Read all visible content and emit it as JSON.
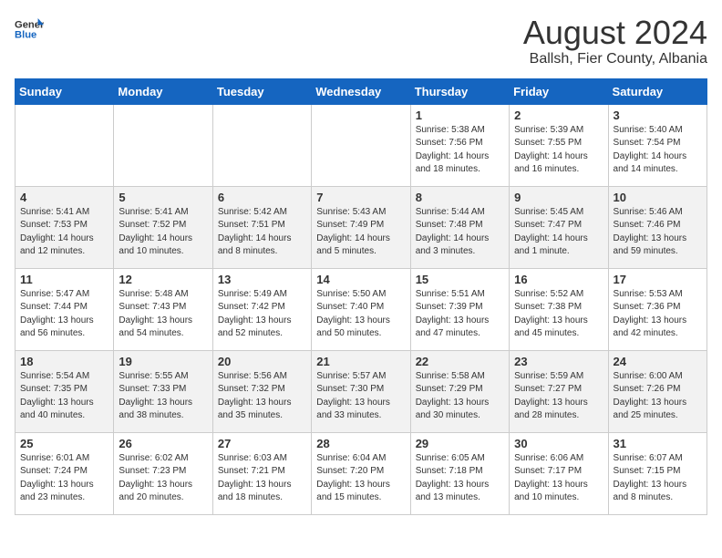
{
  "header": {
    "logo_general": "General",
    "logo_blue": "Blue",
    "month_year": "August 2024",
    "location": "Ballsh, Fier County, Albania"
  },
  "days_of_week": [
    "Sunday",
    "Monday",
    "Tuesday",
    "Wednesday",
    "Thursday",
    "Friday",
    "Saturday"
  ],
  "weeks": [
    [
      {
        "day": "",
        "info": ""
      },
      {
        "day": "",
        "info": ""
      },
      {
        "day": "",
        "info": ""
      },
      {
        "day": "",
        "info": ""
      },
      {
        "day": "1",
        "info": "Sunrise: 5:38 AM\nSunset: 7:56 PM\nDaylight: 14 hours\nand 18 minutes."
      },
      {
        "day": "2",
        "info": "Sunrise: 5:39 AM\nSunset: 7:55 PM\nDaylight: 14 hours\nand 16 minutes."
      },
      {
        "day": "3",
        "info": "Sunrise: 5:40 AM\nSunset: 7:54 PM\nDaylight: 14 hours\nand 14 minutes."
      }
    ],
    [
      {
        "day": "4",
        "info": "Sunrise: 5:41 AM\nSunset: 7:53 PM\nDaylight: 14 hours\nand 12 minutes."
      },
      {
        "day": "5",
        "info": "Sunrise: 5:41 AM\nSunset: 7:52 PM\nDaylight: 14 hours\nand 10 minutes."
      },
      {
        "day": "6",
        "info": "Sunrise: 5:42 AM\nSunset: 7:51 PM\nDaylight: 14 hours\nand 8 minutes."
      },
      {
        "day": "7",
        "info": "Sunrise: 5:43 AM\nSunset: 7:49 PM\nDaylight: 14 hours\nand 5 minutes."
      },
      {
        "day": "8",
        "info": "Sunrise: 5:44 AM\nSunset: 7:48 PM\nDaylight: 14 hours\nand 3 minutes."
      },
      {
        "day": "9",
        "info": "Sunrise: 5:45 AM\nSunset: 7:47 PM\nDaylight: 14 hours\nand 1 minute."
      },
      {
        "day": "10",
        "info": "Sunrise: 5:46 AM\nSunset: 7:46 PM\nDaylight: 13 hours\nand 59 minutes."
      }
    ],
    [
      {
        "day": "11",
        "info": "Sunrise: 5:47 AM\nSunset: 7:44 PM\nDaylight: 13 hours\nand 56 minutes."
      },
      {
        "day": "12",
        "info": "Sunrise: 5:48 AM\nSunset: 7:43 PM\nDaylight: 13 hours\nand 54 minutes."
      },
      {
        "day": "13",
        "info": "Sunrise: 5:49 AM\nSunset: 7:42 PM\nDaylight: 13 hours\nand 52 minutes."
      },
      {
        "day": "14",
        "info": "Sunrise: 5:50 AM\nSunset: 7:40 PM\nDaylight: 13 hours\nand 50 minutes."
      },
      {
        "day": "15",
        "info": "Sunrise: 5:51 AM\nSunset: 7:39 PM\nDaylight: 13 hours\nand 47 minutes."
      },
      {
        "day": "16",
        "info": "Sunrise: 5:52 AM\nSunset: 7:38 PM\nDaylight: 13 hours\nand 45 minutes."
      },
      {
        "day": "17",
        "info": "Sunrise: 5:53 AM\nSunset: 7:36 PM\nDaylight: 13 hours\nand 42 minutes."
      }
    ],
    [
      {
        "day": "18",
        "info": "Sunrise: 5:54 AM\nSunset: 7:35 PM\nDaylight: 13 hours\nand 40 minutes."
      },
      {
        "day": "19",
        "info": "Sunrise: 5:55 AM\nSunset: 7:33 PM\nDaylight: 13 hours\nand 38 minutes."
      },
      {
        "day": "20",
        "info": "Sunrise: 5:56 AM\nSunset: 7:32 PM\nDaylight: 13 hours\nand 35 minutes."
      },
      {
        "day": "21",
        "info": "Sunrise: 5:57 AM\nSunset: 7:30 PM\nDaylight: 13 hours\nand 33 minutes."
      },
      {
        "day": "22",
        "info": "Sunrise: 5:58 AM\nSunset: 7:29 PM\nDaylight: 13 hours\nand 30 minutes."
      },
      {
        "day": "23",
        "info": "Sunrise: 5:59 AM\nSunset: 7:27 PM\nDaylight: 13 hours\nand 28 minutes."
      },
      {
        "day": "24",
        "info": "Sunrise: 6:00 AM\nSunset: 7:26 PM\nDaylight: 13 hours\nand 25 minutes."
      }
    ],
    [
      {
        "day": "25",
        "info": "Sunrise: 6:01 AM\nSunset: 7:24 PM\nDaylight: 13 hours\nand 23 minutes."
      },
      {
        "day": "26",
        "info": "Sunrise: 6:02 AM\nSunset: 7:23 PM\nDaylight: 13 hours\nand 20 minutes."
      },
      {
        "day": "27",
        "info": "Sunrise: 6:03 AM\nSunset: 7:21 PM\nDaylight: 13 hours\nand 18 minutes."
      },
      {
        "day": "28",
        "info": "Sunrise: 6:04 AM\nSunset: 7:20 PM\nDaylight: 13 hours\nand 15 minutes."
      },
      {
        "day": "29",
        "info": "Sunrise: 6:05 AM\nSunset: 7:18 PM\nDaylight: 13 hours\nand 13 minutes."
      },
      {
        "day": "30",
        "info": "Sunrise: 6:06 AM\nSunset: 7:17 PM\nDaylight: 13 hours\nand 10 minutes."
      },
      {
        "day": "31",
        "info": "Sunrise: 6:07 AM\nSunset: 7:15 PM\nDaylight: 13 hours\nand 8 minutes."
      }
    ]
  ]
}
